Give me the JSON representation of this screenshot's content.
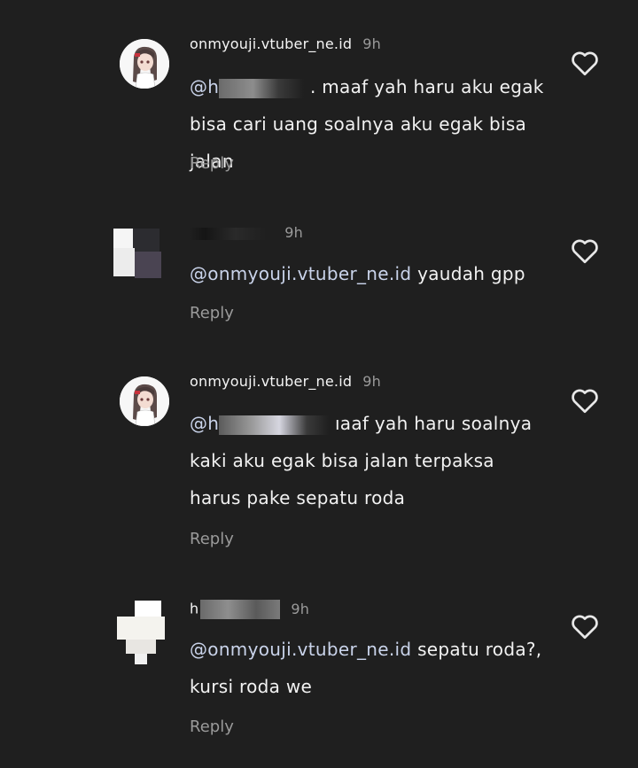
{
  "comments": [
    {
      "username": "onmyouji.vtuber_ne.id",
      "time": "9h",
      "mention": "@h",
      "text": ". maaf yah haru aku egak bisa cari uang soalnya aku egak bisa jalan",
      "reply": "Reply"
    },
    {
      "username": "",
      "time": "9h",
      "mention": "@onmyouji.vtuber_ne.id",
      "text": "yaudah gpp",
      "reply": "Reply"
    },
    {
      "username": "onmyouji.vtuber_ne.id",
      "time": "9h",
      "mention": "@h",
      "text": "ıaaf yah haru soalnya kaki aku egak bisa jalan terpaksa harus pake sepatu roda",
      "reply": "Reply"
    },
    {
      "username": "h",
      "time": "9h",
      "mention": "@onmyouji.vtuber_ne.id",
      "text": "sepatu roda?, kursi roda we",
      "reply": "Reply"
    }
  ],
  "icons": {
    "like": "heart-outline-icon"
  },
  "colors": {
    "background": "#1f1f1f",
    "text": "#f2f2f2",
    "muted": "#9a9a9a",
    "mention": "#c9d3ea"
  }
}
